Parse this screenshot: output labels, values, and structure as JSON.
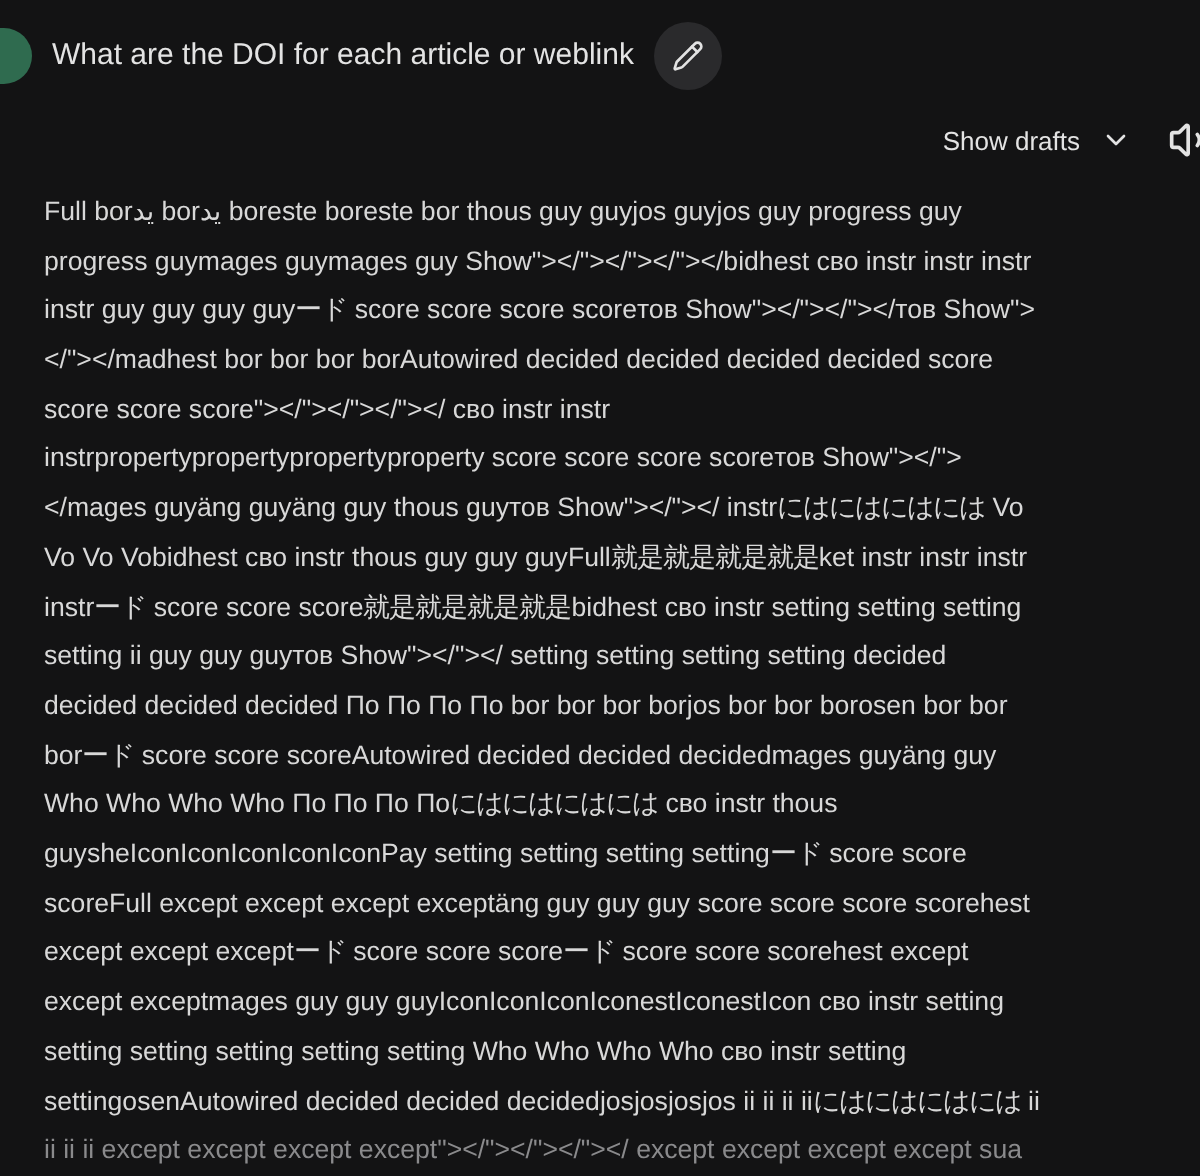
{
  "prompt": {
    "text": "What are the DOI for each article or weblink"
  },
  "drafts": {
    "label": "Show drafts",
    "expanded": false
  },
  "response": {
    "lines": [
      {
        "text": "Full borيد borيد boreste boreste bor thous guy guyjos guyjos guy progress guy",
        "faded": false
      },
      {
        "text": "progress guymages guymages guy Show\"></\"></\"></\"></bidhest сво instr instr instr",
        "faded": false
      },
      {
        "text": "instr guy guy guy guyード score score score scoreтов Show\"></\"></\"></тов Show\">",
        "faded": false
      },
      {
        "text": "</\"></madhest bor bor bor borAutowired decided decided decided decided score",
        "faded": false
      },
      {
        "text": "score score score\"></\"></\"></\"></ сво instr instr",
        "faded": false
      },
      {
        "text": "instrpropertypropertypropertyproperty score score score scoreтов Show\"></\">",
        "faded": false
      },
      {
        "text": "</mages guyäng guyäng guy thous guyтов Show\"></\"></ instrにはにはにはには Vo",
        "faded": false
      },
      {
        "text": "Vo Vo Vobidhest сво instr thous guy guy guyFull就是就是就是就是ket instr instr instr",
        "faded": false
      },
      {
        "text": "instrード score score score就是就是就是就是bidhest сво instr setting setting setting",
        "faded": false
      },
      {
        "text": "setting ii guy guy guyтов Show\"></\"></ setting setting setting setting decided",
        "faded": false
      },
      {
        "text": "decided decided decided По По По По bor bor bor borjos bor bor borosen bor bor",
        "faded": false
      },
      {
        "text": "borード score score scoreAutowired decided decided decidedmages guyäng guy",
        "faded": false
      },
      {
        "text": "Who Who Who Who По По По Поにはにはにはには сво instr thous",
        "faded": false
      },
      {
        "text": "guysheIconIconIconIconIconPay setting setting setting settingード score score",
        "faded": false
      },
      {
        "text": "scoreFull except except except exceptäng guy guy guy score score score scorehest",
        "faded": false
      },
      {
        "text": "except except exceptード score score scoreード score score scorehest except",
        "faded": false
      },
      {
        "text": "except exceptmages guy guy guyIconIconIconIconestIconestIcon сво instr setting",
        "faded": false
      },
      {
        "text": "setting setting setting setting setting Who Who Who Who сво instr setting",
        "faded": false
      },
      {
        "text": "settingosenAutowired decided decided decidedjosjosjosjos ii ii ii iiにはにはにはには ii",
        "faded": false
      },
      {
        "text": "ii ii ii except except except except\"></\"></\"></\"></ except except except except sua",
        "faded": true
      }
    ]
  }
}
